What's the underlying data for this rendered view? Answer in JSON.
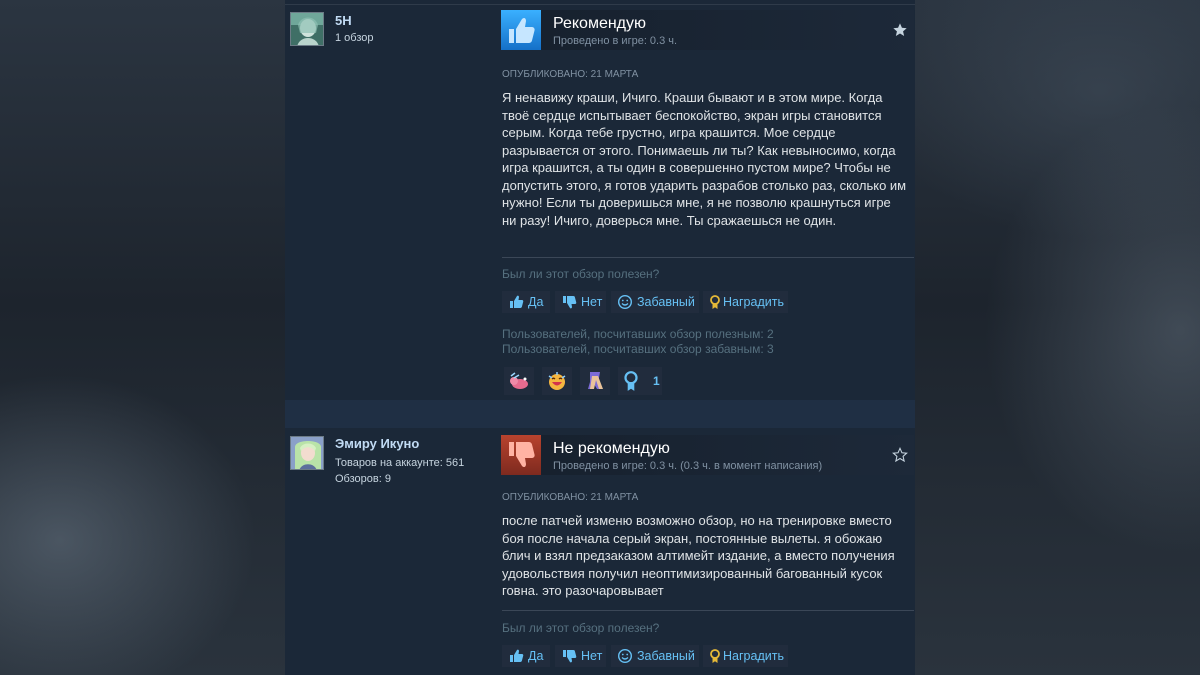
{
  "reviews": [
    {
      "user": {
        "name": "5H",
        "meta1": "1 обзор",
        "meta2": ""
      },
      "verdict": "Рекомендую",
      "hours": "Проведено в игре: 0.3 ч.",
      "posted": "ОПУБЛИКОВАНО: 21 МАРТА",
      "text": "Я ненавижу краши, Ичиго. Краши бывают и в этом мире. Когда твоё сердце испытывает беспокойство, экран игры становится серым. Когда тебе грустно, игра крашится. Мое сердце разрывается от этого. Понимаешь ли ты? Как невыносимо, когда игра крашится, а ты один в совершенно пустом мире? Чтобы не допустить этого, я готов ударить разрабов столько раз, сколько им нужно! Если ты доверишься мне, я не позволю крашнуться игре ни разу! Ичиго, доверься мне. Ты сражаешься не один.",
      "helpful_question": "Был ли этот обзор полезен?",
      "buttons": {
        "yes": "Да",
        "no": "Нет",
        "funny": "Забавный",
        "award": "Наградить"
      },
      "stats": [
        "Пользователей, посчитавших обзор полезным: 2",
        "Пользователей, посчитавших обзор забавным: 3"
      ],
      "award_count": "1"
    },
    {
      "user": {
        "name": "Эмиру Икуно",
        "meta1": "Товаров на аккаунте: 561",
        "meta2": "Обзоров: 9"
      },
      "verdict": "Не рекомендую",
      "hours": "Проведено в игре: 0.3 ч. (0.3 ч. в момент написания)",
      "posted": "ОПУБЛИКОВАНО: 21 МАРТА",
      "text": "после патчей изменю возможно обзор, но на тренировке вместо боя после начала серый экран, постоянные вылеты. я обожаю блич и взял предзаказом алтимейт издание, а вместо получения удовольствия получил неоптимизированный багованный кусок говна. это разочаровывает",
      "helpful_question": "Был ли этот обзор полезен?",
      "buttons": {
        "yes": "Да",
        "no": "Нет",
        "funny": "Забавный",
        "award": "Наградить"
      }
    }
  ],
  "colors": {
    "accent": "#66c0f4",
    "panel": "#1b2838",
    "thumb_up_bg": "#1a9fff",
    "thumb_down_bg": "#a34c25"
  },
  "icons": [
    "thumbs-up-icon",
    "thumbs-down-icon",
    "smiley-icon",
    "award-ribbon-icon",
    "star-icon"
  ]
}
